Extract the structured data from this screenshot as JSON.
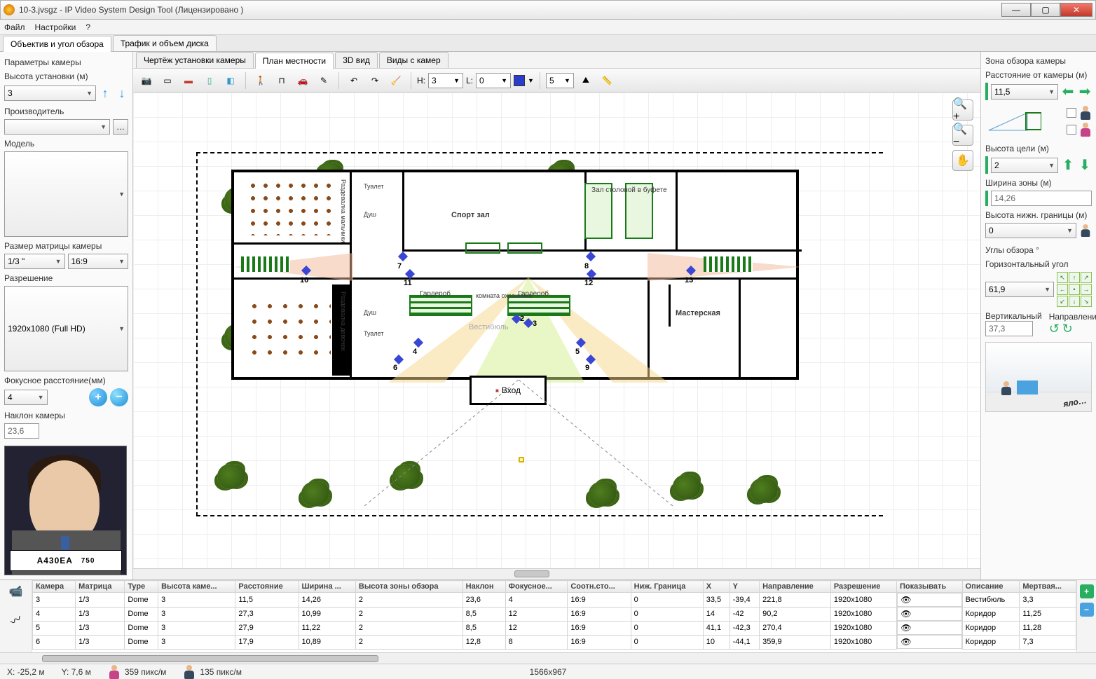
{
  "window": {
    "title": "10-3.jvsgz - IP Video System Design Tool (Лицензировано",
    "title_tail": ")"
  },
  "menu": {
    "file": "Файл",
    "settings": "Настройки",
    "help": "?"
  },
  "mainTabs": {
    "lens": "Объектив и угол обзора",
    "traffic": "Трафик и объем диска"
  },
  "left": {
    "section": "Параметры камеры",
    "heightLbl": "Высота установки (м)",
    "height": "3",
    "manufLbl": "Производитель",
    "manuf": "",
    "modelLbl": "Модель",
    "model": "",
    "sensorLbl": "Размер матрицы камеры",
    "sensor": "1/3 \"",
    "aspect": "16:9",
    "resLbl": "Разрешение",
    "res": "1920x1080 (Full HD)",
    "focalLbl": "Фокусное расстояние(мм)",
    "focal": "4",
    "tiltLbl": "Наклон камеры",
    "tilt": "23,6",
    "plate": "A430EA",
    "plateRegion": "750"
  },
  "centerTabs": {
    "install": "Чертёж установки камеры",
    "plan": "План местности",
    "view3d": "3D вид",
    "camviews": "Виды с камер"
  },
  "toolbar": {
    "h": "H:",
    "hval": "3",
    "l": "L:",
    "lval": "0",
    "count": "5"
  },
  "plan": {
    "sport": "Спорт зал",
    "buffet": "Зал столовой в буфете",
    "guard": "комната охранника",
    "ward1": "Гардероб",
    "ward2": "Гардероб",
    "work": "Мастерская",
    "entry": "Вход",
    "dressM": "Раздевалка мальчики",
    "dressF": "Раздевалка девочек",
    "shower1": "Душ",
    "shower2": "Душ",
    "toilet": "Туалет",
    "toilet2": "Туалет",
    "vest": "Вестибюль",
    "n2": "2",
    "n3": "3",
    "n4": "4",
    "n5": "5",
    "n6": "6",
    "n7": "7",
    "n8": "8",
    "n9": "9",
    "n10": "10",
    "n11": "11",
    "n12": "12",
    "n13": "13"
  },
  "right": {
    "header": "Зона обзора камеры",
    "distLbl": "Расстояние от камеры (м)",
    "dist": "11,5",
    "targetHLbl": "Высота цели (м)",
    "targetH": "2",
    "zoneWLbl": "Ширина зоны (м)",
    "zoneW": "14,26",
    "lowerHLbl": "Высота нижн. границы (м)",
    "lowerH": "0",
    "anglesLbl": "Углы обзора °",
    "hAngleLbl": "Горизонтальный угол",
    "hAngle": "61,9",
    "vAngleLbl": "Вертикальный",
    "vAngle": "37,3",
    "dirLbl": "Направление"
  },
  "table": {
    "cols": [
      "Камера",
      "Матрица",
      "Type",
      "Высота каме...",
      "Расстояние",
      "Ширина ...",
      "Высота зоны обзора",
      "Наклон",
      "Фокусное...",
      "Соотн.сто...",
      "Ниж. Граница",
      "X",
      "Y",
      "Направление",
      "Разрешение",
      "Показывать",
      "Описание",
      "Мертвая..."
    ],
    "rows": [
      [
        "3",
        "1/3",
        "Dome",
        "3",
        "11,5",
        "14,26",
        "2",
        "23,6",
        "4",
        "16:9",
        "0",
        "33,5",
        "-39,4",
        "221,8",
        "1920x1080",
        "👁",
        "Вестибюль",
        "3,3"
      ],
      [
        "4",
        "1/3",
        "Dome",
        "3",
        "27,3",
        "10,99",
        "2",
        "8,5",
        "12",
        "16:9",
        "0",
        "14",
        "-42",
        "90,2",
        "1920x1080",
        "👁",
        "Коридор",
        "11,25"
      ],
      [
        "5",
        "1/3",
        "Dome",
        "3",
        "27,9",
        "11,22",
        "2",
        "8,5",
        "12",
        "16:9",
        "0",
        "41,1",
        "-42,3",
        "270,4",
        "1920x1080",
        "👁",
        "Коридор",
        "11,28"
      ],
      [
        "6",
        "1/3",
        "Dome",
        "3",
        "17,9",
        "10,89",
        "2",
        "12,8",
        "8",
        "16:9",
        "0",
        "10",
        "-44,1",
        "359,9",
        "1920x1080",
        "👁",
        "Коридор",
        "7,3"
      ]
    ]
  },
  "status": {
    "x": "X: -25,2 м",
    "y": "Y: 7,6 м",
    "px1": "359 пикс/м",
    "px2": "135 пикс/м",
    "dims": "1566x967"
  }
}
